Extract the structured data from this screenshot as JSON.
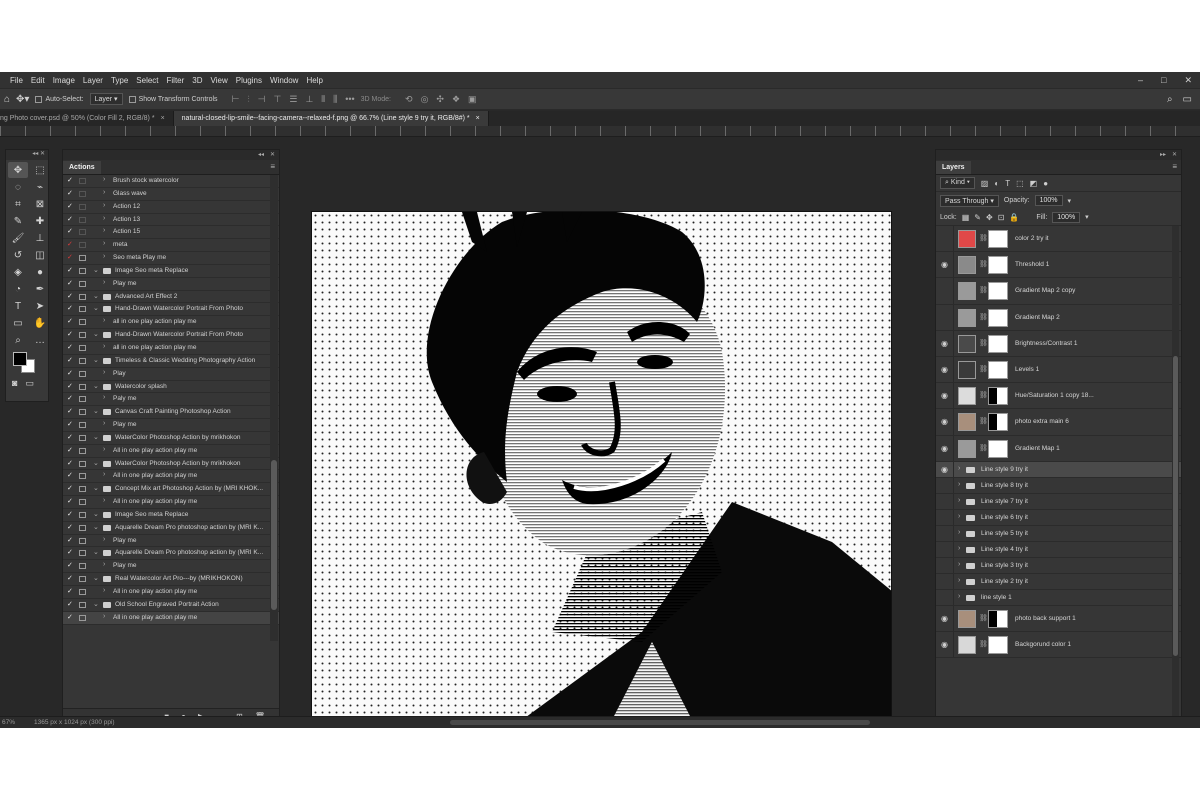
{
  "menubar": {
    "items": [
      "File",
      "Edit",
      "Image",
      "Layer",
      "Type",
      "Select",
      "Filter",
      "3D",
      "View",
      "Plugins",
      "Window",
      "Help"
    ],
    "window_controls": [
      "–",
      "□",
      "✕"
    ]
  },
  "options_bar": {
    "auto_select_label": "Auto-Select:",
    "auto_select_target": "Layer",
    "show_transform_label": "Show Transform Controls",
    "mode_3d_label": "3D Mode:"
  },
  "tabs": [
    {
      "label": "ng Photo cover.psd @ 50% (Color Fill 2, RGB/8) *",
      "active": false
    },
    {
      "label": "natural-closed-lip-smile--facing-camera--relaxed-f.png @ 66.7% (Line style 9 try it, RGB/8#) *",
      "active": true
    }
  ],
  "tools": {
    "icons": [
      "move-icon",
      "marquee-icon",
      "lasso-icon",
      "quick-select-icon",
      "crop-icon",
      "frame-icon",
      "eyedropper-icon",
      "healing-icon",
      "brush-icon",
      "stamp-icon",
      "history-brush-icon",
      "eraser-icon",
      "bucket-icon",
      "blur-icon",
      "dodge-icon",
      "pen-icon",
      "type-icon",
      "path-select-icon",
      "shape-icon",
      "hand-icon",
      "zoom-icon",
      "more-icon"
    ],
    "glyphs": [
      "✥",
      "⬚",
      "◌",
      "⌁",
      "⌗",
      "⊠",
      "✎",
      "✚",
      "🖌",
      "⊥",
      "↺",
      "◫",
      "◈",
      "●",
      "◔",
      "✒",
      "T",
      "➤",
      "▭",
      "✋",
      "⌕",
      "…"
    ],
    "foreground": "#000000",
    "background": "#ffffff"
  },
  "actions_panel": {
    "title": "Actions",
    "items": [
      {
        "label": "Brush stock watercolor",
        "indent": 1,
        "folder": false,
        "check": "white",
        "dialog": false
      },
      {
        "label": "Glass wave",
        "indent": 1,
        "folder": false,
        "check": "white",
        "dialog": false
      },
      {
        "label": "Action 12",
        "indent": 1,
        "folder": false,
        "check": "white",
        "dialog": false
      },
      {
        "label": "Action 13",
        "indent": 1,
        "folder": false,
        "check": "white",
        "dialog": false
      },
      {
        "label": "Action 15",
        "indent": 1,
        "folder": false,
        "check": "white",
        "dialog": false
      },
      {
        "label": "meta",
        "indent": 1,
        "folder": false,
        "check": "red",
        "dialog": false
      },
      {
        "label": "Seo meta Play me",
        "indent": 1,
        "folder": false,
        "check": "red",
        "dialog": true
      },
      {
        "label": "Image Seo meta Replace",
        "indent": 0,
        "folder": true,
        "check": "white",
        "dialog": true
      },
      {
        "label": "Play me",
        "indent": 1,
        "folder": false,
        "check": "white",
        "dialog": true
      },
      {
        "label": "Advanced Art Effect 2",
        "indent": 0,
        "folder": true,
        "check": "white",
        "dialog": true
      },
      {
        "label": "Hand-Drawn Watercolor Portrait From Photo",
        "indent": 0,
        "folder": true,
        "check": "white",
        "dialog": true
      },
      {
        "label": "all in one play action play me",
        "indent": 1,
        "folder": false,
        "check": "white",
        "dialog": true
      },
      {
        "label": "Hand-Drawn Watercolor Portrait From Photo",
        "indent": 0,
        "folder": true,
        "check": "white",
        "dialog": true
      },
      {
        "label": "all in one play action play me",
        "indent": 1,
        "folder": false,
        "check": "white",
        "dialog": true
      },
      {
        "label": "Timeless & Classic Wedding Photography Action",
        "indent": 0,
        "folder": true,
        "check": "white",
        "dialog": true
      },
      {
        "label": "Play",
        "indent": 1,
        "folder": false,
        "check": "white",
        "dialog": true
      },
      {
        "label": "Watercolor splash",
        "indent": 0,
        "folder": true,
        "check": "white",
        "dialog": true
      },
      {
        "label": "Paly me",
        "indent": 1,
        "folder": false,
        "check": "white",
        "dialog": true
      },
      {
        "label": "Canvas Craft Painting Photoshop Action",
        "indent": 0,
        "folder": true,
        "check": "white",
        "dialog": true
      },
      {
        "label": "Play me",
        "indent": 1,
        "folder": false,
        "check": "white",
        "dialog": true
      },
      {
        "label": "WaterColor Photoshop Action by mrikhokon",
        "indent": 0,
        "folder": true,
        "check": "white",
        "dialog": true
      },
      {
        "label": "All in one play action play me",
        "indent": 1,
        "folder": false,
        "check": "white",
        "dialog": true
      },
      {
        "label": "WaterColor Photoshop Action by mrikhokon",
        "indent": 0,
        "folder": true,
        "check": "white",
        "dialog": true
      },
      {
        "label": "All in one play action play me",
        "indent": 1,
        "folder": false,
        "check": "white",
        "dialog": true
      },
      {
        "label": "Concept Mix art Photoshop Action by (MRI KHOK...",
        "indent": 0,
        "folder": true,
        "check": "white",
        "dialog": true
      },
      {
        "label": "All in one play action play me",
        "indent": 1,
        "folder": false,
        "check": "white",
        "dialog": true
      },
      {
        "label": "Image Seo meta Replace",
        "indent": 0,
        "folder": true,
        "check": "white",
        "dialog": true
      },
      {
        "label": "Aquarelle Dream Pro photoshop action by (MRI K...",
        "indent": 0,
        "folder": true,
        "check": "white",
        "dialog": true
      },
      {
        "label": "Play me",
        "indent": 1,
        "folder": false,
        "check": "white",
        "dialog": true
      },
      {
        "label": "Aquarelle Dream Pro photoshop action by (MRI K...",
        "indent": 0,
        "folder": true,
        "check": "white",
        "dialog": true
      },
      {
        "label": "Play me",
        "indent": 1,
        "folder": false,
        "check": "white",
        "dialog": true
      },
      {
        "label": "Real Watercolor Art Pro---by (MRIKHOKON)",
        "indent": 0,
        "folder": true,
        "check": "white",
        "dialog": true
      },
      {
        "label": "All in one play action play me",
        "indent": 1,
        "folder": false,
        "check": "white",
        "dialog": true
      },
      {
        "label": "Old School Engraved Portrait Action",
        "indent": 0,
        "folder": true,
        "check": "white",
        "dialog": true
      },
      {
        "label": "All in one play action play me",
        "indent": 1,
        "folder": false,
        "check": "white",
        "dialog": true,
        "highlight": true
      }
    ]
  },
  "layers_panel": {
    "title": "Layers",
    "filter_kind": "Kind",
    "blend_mode": "Pass Through",
    "opacity_label": "Opacity:",
    "opacity_value": "100%",
    "lock_label": "Lock:",
    "fill_label": "Fill:",
    "fill_value": "100%",
    "layers": [
      {
        "name": "color 2 try it",
        "type": "fill",
        "visible": false,
        "thumb": "#e04848"
      },
      {
        "name": "Threshold 1",
        "type": "adjust",
        "visible": true,
        "thumb": "#8a8a8a"
      },
      {
        "name": "Gradient Map 2 copy",
        "type": "adjust",
        "visible": false,
        "thumb": "#9a9a9a"
      },
      {
        "name": "Gradient Map 2",
        "type": "adjust",
        "visible": false,
        "thumb": "#9a9a9a"
      },
      {
        "name": "Brightness/Contrast 1",
        "type": "adjust",
        "visible": true,
        "thumb": "#4a4a4a"
      },
      {
        "name": "Levels 1",
        "type": "adjust",
        "visible": true,
        "thumb": "#3a3a3a"
      },
      {
        "name": "Hue/Saturation 1 copy 18...",
        "type": "image",
        "visible": true,
        "thumb": "#dcdcdc"
      },
      {
        "name": "photo extra main 6",
        "type": "image",
        "visible": true,
        "thumb": "#a88f7c"
      },
      {
        "name": "Gradient Map 1",
        "type": "adjust",
        "visible": true,
        "thumb": "#9a9a9a"
      },
      {
        "name": "Line style 9 try it",
        "type": "group",
        "visible": true,
        "selected": true
      },
      {
        "name": "Line style 8 try it",
        "type": "group",
        "visible": false
      },
      {
        "name": "Line style 7 try it",
        "type": "group",
        "visible": false
      },
      {
        "name": "Line style 6 try it",
        "type": "group",
        "visible": false
      },
      {
        "name": "Line style 5 try it",
        "type": "group",
        "visible": false
      },
      {
        "name": "Line style 4 try it",
        "type": "group",
        "visible": false
      },
      {
        "name": "Line style 3 try it",
        "type": "group",
        "visible": false
      },
      {
        "name": "Line style 2 try it",
        "type": "group",
        "visible": false
      },
      {
        "name": "line style 1",
        "type": "group",
        "visible": false
      },
      {
        "name": "photo back support 1",
        "type": "image",
        "visible": true,
        "thumb": "#a88f7c"
      },
      {
        "name": "Backgorund color 1",
        "type": "fill",
        "visible": true,
        "thumb": "#d8d8d8"
      }
    ]
  },
  "statusbar": {
    "zoom": "67%",
    "doc_info": "1365 px x 1024 px (300 ppi)"
  }
}
